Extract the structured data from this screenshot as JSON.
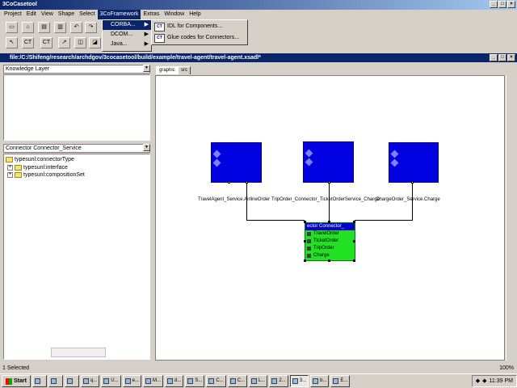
{
  "window": {
    "title": "3CoCasetool"
  },
  "menubar": {
    "items": [
      "Project",
      "Edit",
      "View",
      "Shape",
      "Select",
      "3CoFramework",
      "Extras",
      "Window",
      "Help"
    ],
    "active_index": 5
  },
  "framework_menu": {
    "items": [
      {
        "label": "CORBA...",
        "arrow": "▶"
      },
      {
        "label": "DCOM...",
        "arrow": "▶"
      },
      {
        "label": "Java...",
        "arrow": "▶"
      }
    ]
  },
  "corba_submenu": {
    "items": [
      {
        "icon_text": "CT",
        "label": "IDL for Components..."
      },
      {
        "icon_text": "CT",
        "label": "Glue codes for Connectors..."
      }
    ]
  },
  "document": {
    "title": "file:/C:/Shifeng/research/archdgov/3cocasetool/build/example/travel-agent/travel-agent.xsadl*"
  },
  "left_panel": {
    "top_combo": "Knowledge Layer",
    "bottom_combo": "Connector Connector_Service",
    "tree": [
      {
        "label": "typesunl:connectorType",
        "expander": ""
      },
      {
        "label": "typesunl:interface",
        "expander": "+"
      },
      {
        "label": "typesunl:compositionSet",
        "expander": "+"
      }
    ]
  },
  "tabs": [
    "graphic",
    "src"
  ],
  "diagram": {
    "label_row": "TravelAgent_Service.Air... [overlapping: TripOrder_Connector_Ti...TicketOrder...ChargeOrder_Service.Charge] ... ChargeOrder_Service.Charge",
    "label_left": "TravelAgent_Service.AirlineOrder",
    "label_mid": "TripOrder_Connector_TicketOrderService_Charge",
    "label_right": "ChargeOrder_Service.Charge",
    "connector": {
      "title": "ector Connector_",
      "items": [
        "TravelOrder",
        "TicketOrder",
        "TripOrder",
        "Charge"
      ]
    }
  },
  "status": {
    "left": "1 Selected",
    "right": "100%"
  },
  "taskbar": {
    "start": "Start",
    "buttons": [
      "",
      "",
      "",
      "",
      "q...",
      "U...",
      "e...",
      "M...",
      "d...",
      "S...",
      "C...",
      "C...",
      "L...",
      "2...",
      "3...",
      "b...",
      "E..."
    ],
    "active_index": 14,
    "clock": "11:39 PM"
  },
  "colors": {
    "component_fill": "#0000e0",
    "connector_fill": "#22e022",
    "title_bar": "#0a246a"
  }
}
